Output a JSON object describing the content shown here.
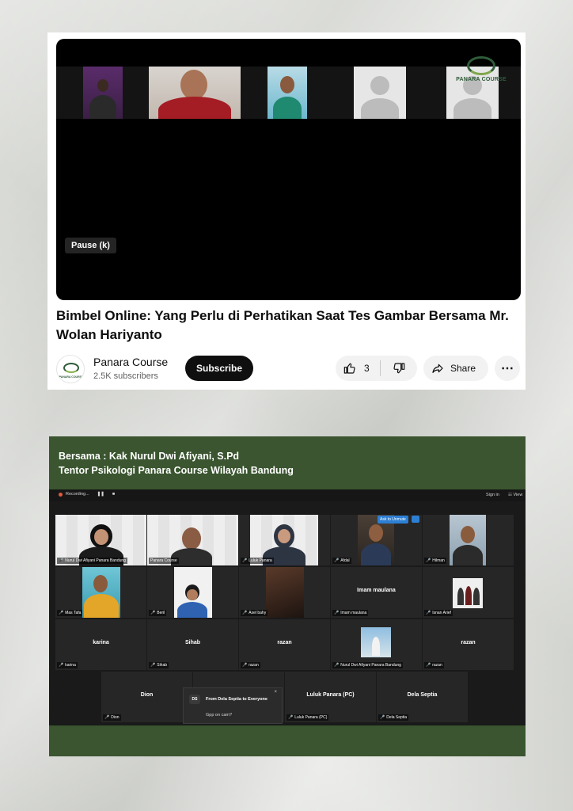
{
  "youtube": {
    "overlay_logo": "PANARA COURSE",
    "pause_tooltip": "Pause (k)",
    "title": "Bimbel Online: Yang Perlu di Perhatikan Saat Tes Gambar Bersama Mr. Wolan Hariyanto",
    "channel": {
      "name": "Panara Course",
      "subscribers": "2.5K subscribers",
      "logo_text": "PANARA COURSE"
    },
    "subscribe_label": "Subscribe",
    "like_count": "3",
    "share_label": "Share",
    "more_label": "⋯"
  },
  "zoom": {
    "heading_line1": "Bersama : Kak Nurul Dwi Afiyani, S.Pd",
    "heading_line2": "Tentor Psikologi Panara Course Wilayah Bandung",
    "recording_label": "Recording...",
    "pause_ctl": "❚❚",
    "stop_ctl": "■",
    "sign_in": "Sign in",
    "view": "View",
    "ask_to_unmute": "Ask to Unmute",
    "tiles": [
      {
        "label": "Nurul Dwi Afiyani Panara Bandung",
        "name": ""
      },
      {
        "label": "Panara Course",
        "name": ""
      },
      {
        "label": "Luluk Panara",
        "name": ""
      },
      {
        "label": "Afdal",
        "name": ""
      },
      {
        "label": "Hilman",
        "name": ""
      },
      {
        "label": "Mas Tafa",
        "name": ""
      },
      {
        "label": "Beril",
        "name": ""
      },
      {
        "label": "Axel bahy",
        "name": ""
      },
      {
        "label": "Imam maulana",
        "name": "Imam maulana"
      },
      {
        "label": "Isnan Arief",
        "name": ""
      },
      {
        "label": "karina",
        "name": "karina"
      },
      {
        "label": "Sihab",
        "name": "Sihab"
      },
      {
        "label": "razan",
        "name": "razan"
      },
      {
        "label": "Nurul Dwi Afiyani Panara Bandung",
        "name": ""
      },
      {
        "label": "razan",
        "name": "razan"
      },
      {
        "label": "Dion",
        "name": "Dion"
      },
      {
        "label": "",
        "name": ""
      },
      {
        "label": "Luluk Panara (PC)",
        "name": "Luluk Panara (PC)"
      },
      {
        "label": "Dela Septia",
        "name": "Dela Septia"
      }
    ],
    "chat": {
      "initials": "DS",
      "from": "From Dela Septia to Everyone",
      "message": "Gpp on cam?",
      "close": "×"
    }
  }
}
